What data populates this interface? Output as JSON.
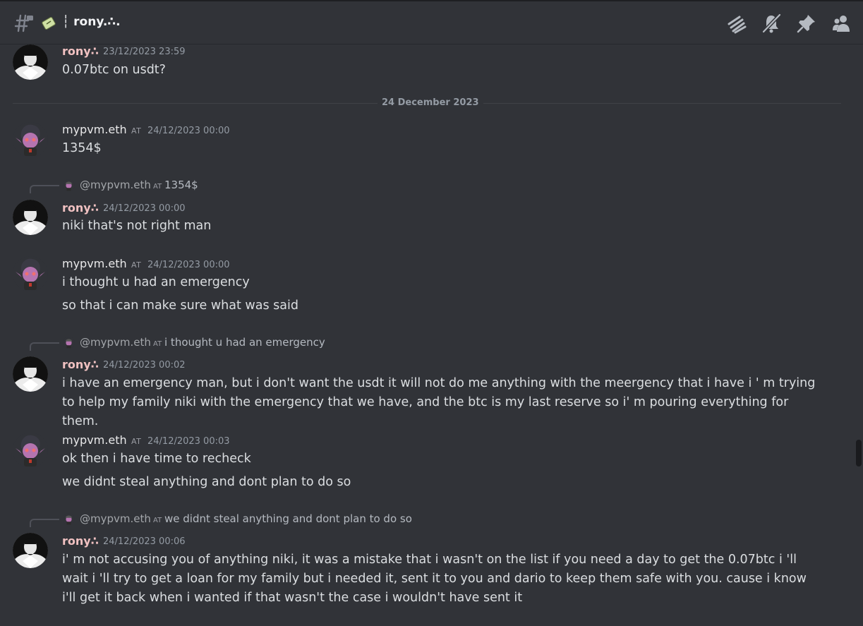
{
  "header": {
    "channel_name": "┆ rony.∴.",
    "icons": [
      "threads-icon",
      "mute-bell-icon",
      "pin-icon",
      "members-icon"
    ]
  },
  "date_divider": "24 December 2023",
  "messages": [
    {
      "author": "rony∴",
      "timestamp": "23/12/2023 23:59",
      "lines": [
        "0.07btc on usdt?"
      ]
    },
    {
      "author": "mypvm.eth",
      "tag": "AT",
      "timestamp": "24/12/2023 00:00",
      "lines": [
        "1354$"
      ]
    },
    {
      "reply": {
        "mention": "@mypvm.eth",
        "tag": "AT",
        "text": "1354$"
      },
      "author": "rony∴",
      "timestamp": "24/12/2023 00:00",
      "lines": [
        "niki that's not right man"
      ]
    },
    {
      "author": "mypvm.eth",
      "tag": "AT",
      "timestamp": "24/12/2023 00:00",
      "lines": [
        "i thought u had an emergency",
        "so that i can make sure what was said"
      ]
    },
    {
      "reply": {
        "mention": "@mypvm.eth",
        "tag": "AT",
        "text": "i thought u had an emergency"
      },
      "author": "rony∴",
      "timestamp": "24/12/2023 00:02",
      "lines": [
        "i have an emergency man, but i don't want the usdt it will not do me anything with the meergency that i have i ' m trying to help my family niki with the emergency that we have, and the btc is my last reserve so i' m pouring everything for them."
      ]
    },
    {
      "author": "mypvm.eth",
      "tag": "AT",
      "timestamp": "24/12/2023 00:03",
      "lines": [
        "ok then i have time to recheck",
        "we didnt steal anything and dont plan to do so"
      ]
    },
    {
      "reply": {
        "mention": "@mypvm.eth",
        "tag": "AT",
        "text": "we didnt steal anything and dont plan to do so"
      },
      "author": "rony∴",
      "timestamp": "24/12/2023 00:06",
      "lines": [
        "i' m not accusing you of anything niki, it was a mistake that i wasn't on the list if you need a day to get the 0.07btc i 'll wait i 'll try to get a loan for my family but i needed it, sent it to you and dario to keep them safe with you. cause i know i'll get it back when i wanted if that wasn't the case i wouldn't have sent it"
      ]
    }
  ]
}
